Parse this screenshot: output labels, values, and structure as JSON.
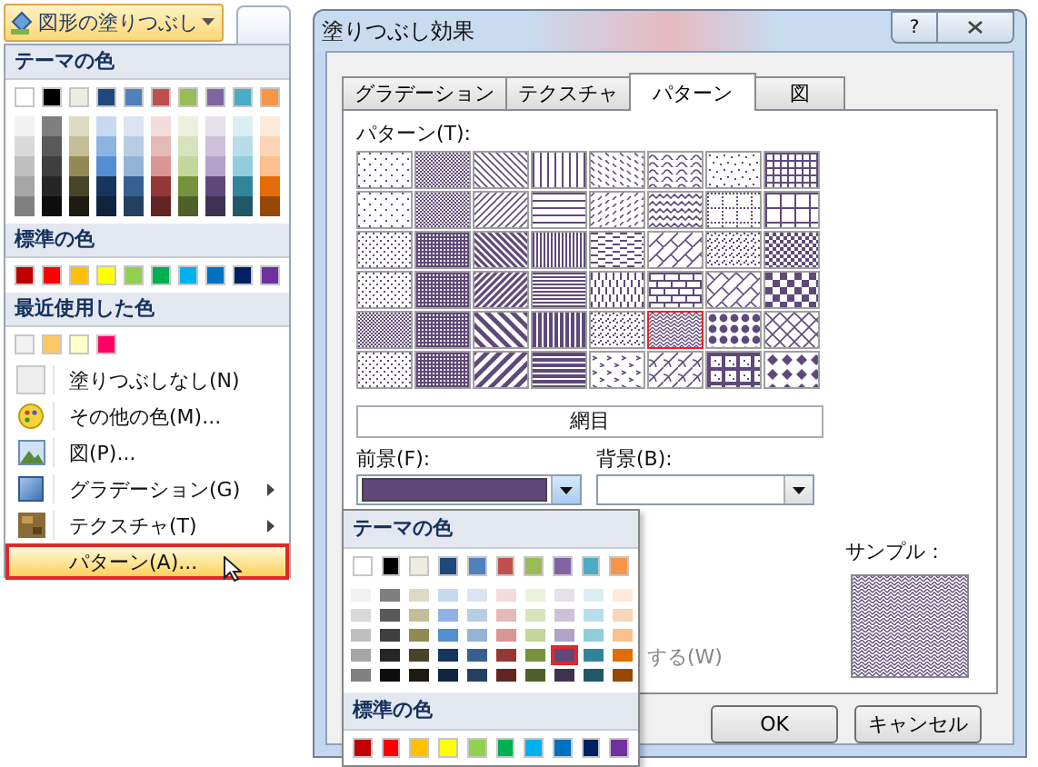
{
  "ribbon": {
    "fill_button": "図形の塗りつぶし"
  },
  "fill_menu": {
    "theme_heading": "テーマの色",
    "theme_colors": [
      {
        "color": "#ffffff"
      },
      {
        "color": "#000000"
      },
      {
        "color": "#eeece1"
      },
      {
        "color": "#1f497d"
      },
      {
        "color": "#4f81bd"
      },
      {
        "color": "#c0504d"
      },
      {
        "color": "#9bbb59"
      },
      {
        "color": "#8064a2"
      },
      {
        "color": "#4bacc6"
      },
      {
        "color": "#f79646"
      }
    ],
    "shade_columns": [
      [
        {
          "color": "#f2f2f2"
        },
        {
          "color": "#d9d9d9"
        },
        {
          "color": "#bfbfbf"
        },
        {
          "color": "#a6a6a6"
        },
        {
          "color": "#808080"
        }
      ],
      [
        {
          "color": "#7f7f7f"
        },
        {
          "color": "#595959"
        },
        {
          "color": "#3f3f3f"
        },
        {
          "color": "#262626"
        },
        {
          "color": "#0d0d0d"
        }
      ],
      [
        {
          "color": "#ddd9c3"
        },
        {
          "color": "#c4bd97"
        },
        {
          "color": "#938953"
        },
        {
          "color": "#494429"
        },
        {
          "color": "#1d1b10"
        }
      ],
      [
        {
          "color": "#c6d9f0"
        },
        {
          "color": "#8db3e2"
        },
        {
          "color": "#548dd4"
        },
        {
          "color": "#17365d"
        },
        {
          "color": "#0f243e"
        }
      ],
      [
        {
          "color": "#dbe5f1"
        },
        {
          "color": "#b8cce4"
        },
        {
          "color": "#95b3d7"
        },
        {
          "color": "#366092"
        },
        {
          "color": "#244061"
        }
      ],
      [
        {
          "color": "#f2dcdb"
        },
        {
          "color": "#e5b9b7"
        },
        {
          "color": "#d99694"
        },
        {
          "color": "#953734"
        },
        {
          "color": "#632423"
        }
      ],
      [
        {
          "color": "#ebf1dd"
        },
        {
          "color": "#d7e3bc"
        },
        {
          "color": "#c3d69b"
        },
        {
          "color": "#76923c"
        },
        {
          "color": "#4f6128"
        }
      ],
      [
        {
          "color": "#e5e0ec"
        },
        {
          "color": "#ccc1d9"
        },
        {
          "color": "#b2a2c7"
        },
        {
          "color": "#5f497a"
        },
        {
          "color": "#3f3151"
        }
      ],
      [
        {
          "color": "#dbeef3"
        },
        {
          "color": "#b7dde8"
        },
        {
          "color": "#92cddc"
        },
        {
          "color": "#31859b"
        },
        {
          "color": "#205867"
        }
      ],
      [
        {
          "color": "#fdeada"
        },
        {
          "color": "#fbd5b5"
        },
        {
          "color": "#fac08f"
        },
        {
          "color": "#e36c09"
        },
        {
          "color": "#974806"
        }
      ]
    ],
    "standard_heading": "標準の色",
    "standard_colors": [
      {
        "color": "#c00000"
      },
      {
        "color": "#ff0000"
      },
      {
        "color": "#ffc000"
      },
      {
        "color": "#ffff00"
      },
      {
        "color": "#92d050"
      },
      {
        "color": "#00b050"
      },
      {
        "color": "#00b0f0"
      },
      {
        "color": "#0070c0"
      },
      {
        "color": "#002060"
      },
      {
        "color": "#7030a0"
      }
    ],
    "recent_heading": "最近使用した色",
    "recent_colors": [
      {
        "color": "#f2f2f2"
      },
      {
        "color": "#fcc864"
      },
      {
        "color": "#ffffcc"
      },
      {
        "color": "#ff0066"
      }
    ],
    "items": [
      {
        "kind": "none",
        "label": "塗りつぶしなし(N)",
        "submenu": false,
        "selected": false
      },
      {
        "kind": "palette",
        "label": "その他の色(M)...",
        "submenu": false,
        "selected": false
      },
      {
        "kind": "picture",
        "label": "図(P)...",
        "submenu": false,
        "selected": false
      },
      {
        "kind": "gradient",
        "label": "グラデーション(G)",
        "submenu": true,
        "selected": false
      },
      {
        "kind": "texture",
        "label": "テクスチャ(T)",
        "submenu": true,
        "selected": false
      },
      {
        "kind": "pattern",
        "label": "パターン(A)...",
        "submenu": false,
        "selected": true
      }
    ]
  },
  "dialog": {
    "title": "塗りつぶし効果",
    "help_button": "?",
    "tabs": [
      {
        "label": "グラデーション",
        "selected": false
      },
      {
        "label": "テクスチャ",
        "selected": false
      },
      {
        "label": "パターン",
        "selected": true
      },
      {
        "label": "図",
        "selected": false
      }
    ],
    "pattern_label": "パターン(T):",
    "patterns": [
      {
        "kind": "sparse-dots",
        "selected": false
      },
      {
        "kind": "dense-dots",
        "selected": false
      },
      {
        "kind": "light-down",
        "selected": false
      },
      {
        "kind": "light-vertical",
        "selected": false
      },
      {
        "kind": "dashed-down",
        "selected": false
      },
      {
        "kind": "wave",
        "selected": false
      },
      {
        "kind": "confetti",
        "selected": false
      },
      {
        "kind": "small-grid",
        "selected": false
      },
      {
        "kind": "sparse-dots",
        "selected": false
      },
      {
        "kind": "dense-dots",
        "selected": false
      },
      {
        "kind": "light-up",
        "selected": false
      },
      {
        "kind": "light-horizontal",
        "selected": false
      },
      {
        "kind": "dashed-up",
        "selected": false
      },
      {
        "kind": "zigzag",
        "selected": false
      },
      {
        "kind": "dotted-grid",
        "selected": false
      },
      {
        "kind": "large-grid",
        "selected": false
      },
      {
        "kind": "dots",
        "selected": false
      },
      {
        "kind": "dark-dots",
        "selected": false
      },
      {
        "kind": "dark-down",
        "selected": false
      },
      {
        "kind": "narrow-vertical",
        "selected": false
      },
      {
        "kind": "dashed-horizontal",
        "selected": false
      },
      {
        "kind": "diagonal-brick",
        "selected": false
      },
      {
        "kind": "small-confetti",
        "selected": false
      },
      {
        "kind": "small-check",
        "selected": false
      },
      {
        "kind": "dots",
        "selected": false
      },
      {
        "kind": "dark-dots",
        "selected": false
      },
      {
        "kind": "dark-up",
        "selected": false
      },
      {
        "kind": "narrow-horizontal",
        "selected": false
      },
      {
        "kind": "dashed-vertical",
        "selected": false
      },
      {
        "kind": "horizontal-brick",
        "selected": false
      },
      {
        "kind": "weave",
        "selected": false
      },
      {
        "kind": "large-check",
        "selected": false
      },
      {
        "kind": "dense-dots",
        "selected": false
      },
      {
        "kind": "dark-dots",
        "selected": false
      },
      {
        "kind": "wide-down",
        "selected": false
      },
      {
        "kind": "dark-vertical",
        "selected": false
      },
      {
        "kind": "small-confetti",
        "selected": false
      },
      {
        "kind": "trellis",
        "selected": true
      },
      {
        "kind": "sphere",
        "selected": false
      },
      {
        "kind": "outlined-diamond",
        "selected": false
      },
      {
        "kind": "dots",
        "selected": false
      },
      {
        "kind": "dark-dots",
        "selected": false
      },
      {
        "kind": "wide-up",
        "selected": false
      },
      {
        "kind": "dark-horizontal",
        "selected": false
      },
      {
        "kind": "divot",
        "selected": false
      },
      {
        "kind": "shingle",
        "selected": false
      },
      {
        "kind": "plaid",
        "selected": false
      },
      {
        "kind": "solid-diamond",
        "selected": false
      }
    ],
    "pattern_name": "網目",
    "foreground_label": "前景(F):",
    "background_label": "背景(B):",
    "foreground": {
      "color": "#5f497a"
    },
    "hidden_option_tail": "する(W)",
    "sample_label": "サンプル：",
    "ok_button": "OK",
    "cancel_button": "キャンセル"
  },
  "color_popup": {
    "theme_heading": "テーマの色",
    "theme_colors": [
      {
        "color": "#ffffff"
      },
      {
        "color": "#000000"
      },
      {
        "color": "#eeece1"
      },
      {
        "color": "#1f497d"
      },
      {
        "color": "#4f81bd"
      },
      {
        "color": "#c0504d"
      },
      {
        "color": "#9bbb59"
      },
      {
        "color": "#8064a2"
      },
      {
        "color": "#4bacc6"
      },
      {
        "color": "#f79646"
      }
    ],
    "shade_columns": [
      [
        {
          "color": "#f2f2f2",
          "selected": false
        },
        {
          "color": "#d9d9d9",
          "selected": false
        },
        {
          "color": "#bfbfbf",
          "selected": false
        },
        {
          "color": "#a6a6a6",
          "selected": false
        },
        {
          "color": "#808080",
          "selected": false
        }
      ],
      [
        {
          "color": "#7f7f7f",
          "selected": false
        },
        {
          "color": "#595959",
          "selected": false
        },
        {
          "color": "#3f3f3f",
          "selected": false
        },
        {
          "color": "#262626",
          "selected": false
        },
        {
          "color": "#0d0d0d",
          "selected": false
        }
      ],
      [
        {
          "color": "#ddd9c3",
          "selected": false
        },
        {
          "color": "#c4bd97",
          "selected": false
        },
        {
          "color": "#938953",
          "selected": false
        },
        {
          "color": "#494429",
          "selected": false
        },
        {
          "color": "#1d1b10",
          "selected": false
        }
      ],
      [
        {
          "color": "#c6d9f0",
          "selected": false
        },
        {
          "color": "#8db3e2",
          "selected": false
        },
        {
          "color": "#548dd4",
          "selected": false
        },
        {
          "color": "#17365d",
          "selected": false
        },
        {
          "color": "#0f243e",
          "selected": false
        }
      ],
      [
        {
          "color": "#dbe5f1",
          "selected": false
        },
        {
          "color": "#b8cce4",
          "selected": false
        },
        {
          "color": "#95b3d7",
          "selected": false
        },
        {
          "color": "#366092",
          "selected": false
        },
        {
          "color": "#244061",
          "selected": false
        }
      ],
      [
        {
          "color": "#f2dcdb",
          "selected": false
        },
        {
          "color": "#e5b9b7",
          "selected": false
        },
        {
          "color": "#d99694",
          "selected": false
        },
        {
          "color": "#953734",
          "selected": false
        },
        {
          "color": "#632423",
          "selected": false
        }
      ],
      [
        {
          "color": "#ebf1dd",
          "selected": false
        },
        {
          "color": "#d7e3bc",
          "selected": false
        },
        {
          "color": "#c3d69b",
          "selected": false
        },
        {
          "color": "#76923c",
          "selected": false
        },
        {
          "color": "#4f6128",
          "selected": false
        }
      ],
      [
        {
          "color": "#e5e0ec",
          "selected": false
        },
        {
          "color": "#ccc1d9",
          "selected": false
        },
        {
          "color": "#b2a2c7",
          "selected": false
        },
        {
          "color": "#5f497a",
          "selected": true
        },
        {
          "color": "#3f3151",
          "selected": false
        }
      ],
      [
        {
          "color": "#dbeef3",
          "selected": false
        },
        {
          "color": "#b7dde8",
          "selected": false
        },
        {
          "color": "#92cddc",
          "selected": false
        },
        {
          "color": "#31859b",
          "selected": false
        },
        {
          "color": "#205867",
          "selected": false
        }
      ],
      [
        {
          "color": "#fdeada",
          "selected": false
        },
        {
          "color": "#fbd5b5",
          "selected": false
        },
        {
          "color": "#fac08f",
          "selected": false
        },
        {
          "color": "#e36c09",
          "selected": false
        },
        {
          "color": "#974806",
          "selected": false
        }
      ]
    ],
    "standard_heading": "標準の色",
    "standard_colors": [
      {
        "color": "#c00000"
      },
      {
        "color": "#ff0000"
      },
      {
        "color": "#ffc000"
      },
      {
        "color": "#ffff00"
      },
      {
        "color": "#92d050"
      },
      {
        "color": "#00b050"
      },
      {
        "color": "#00b0f0"
      },
      {
        "color": "#0070c0"
      },
      {
        "color": "#002060"
      },
      {
        "color": "#7030a0"
      }
    ]
  }
}
